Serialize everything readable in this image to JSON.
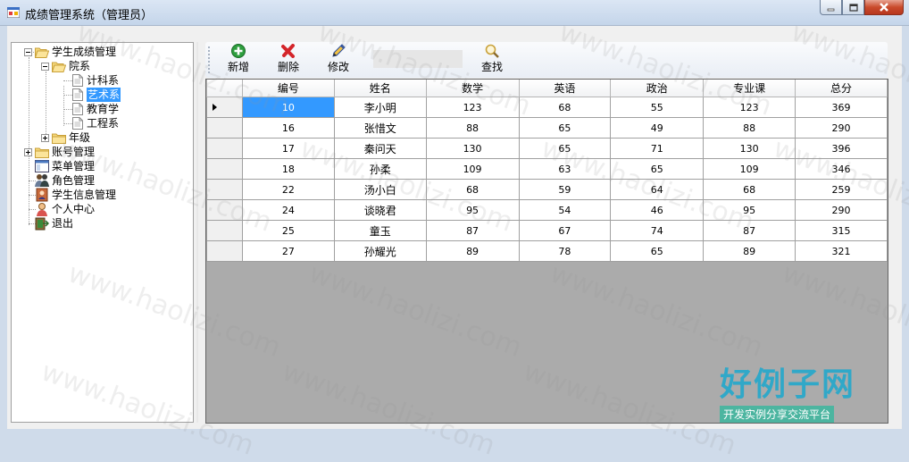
{
  "window": {
    "title": "成绩管理系统（管理员）"
  },
  "tree": {
    "root": "学生成绩管理",
    "departments": "院系",
    "dept_items": [
      "计科系",
      "艺术系",
      "教育学",
      "工程系"
    ],
    "grade": "年级",
    "account_mgmt": "账号管理",
    "menu_mgmt": "菜单管理",
    "role_mgmt": "角色管理",
    "student_info": "学生信息管理",
    "personal_center": "个人中心",
    "exit": "退出",
    "selected": "艺术系"
  },
  "toolbar": {
    "add_label": "新增",
    "delete_label": "删除",
    "edit_label": "修改",
    "search_label": "查找",
    "search_value": ""
  },
  "grid": {
    "columns": [
      "编号",
      "姓名",
      "数学",
      "英语",
      "政治",
      "专业课",
      "总分"
    ],
    "rows": [
      [
        "10",
        "李小明",
        "123",
        "68",
        "55",
        "123",
        "369"
      ],
      [
        "16",
        "张惜文",
        "88",
        "65",
        "49",
        "88",
        "290"
      ],
      [
        "17",
        "秦问天",
        "130",
        "65",
        "71",
        "130",
        "396"
      ],
      [
        "18",
        "孙柔",
        "109",
        "63",
        "65",
        "109",
        "346"
      ],
      [
        "22",
        "汤小白",
        "68",
        "59",
        "64",
        "68",
        "259"
      ],
      [
        "24",
        "谈晓君",
        "95",
        "54",
        "46",
        "95",
        "290"
      ],
      [
        "25",
        "童玉",
        "87",
        "67",
        "74",
        "87",
        "315"
      ],
      [
        "27",
        "孙耀光",
        "89",
        "78",
        "65",
        "89",
        "321"
      ]
    ],
    "current_row": 0
  },
  "watermark": {
    "text": "www.haolizi.com",
    "logo_main": "好例子网",
    "logo_sub": "开发实例分享交流平台"
  }
}
